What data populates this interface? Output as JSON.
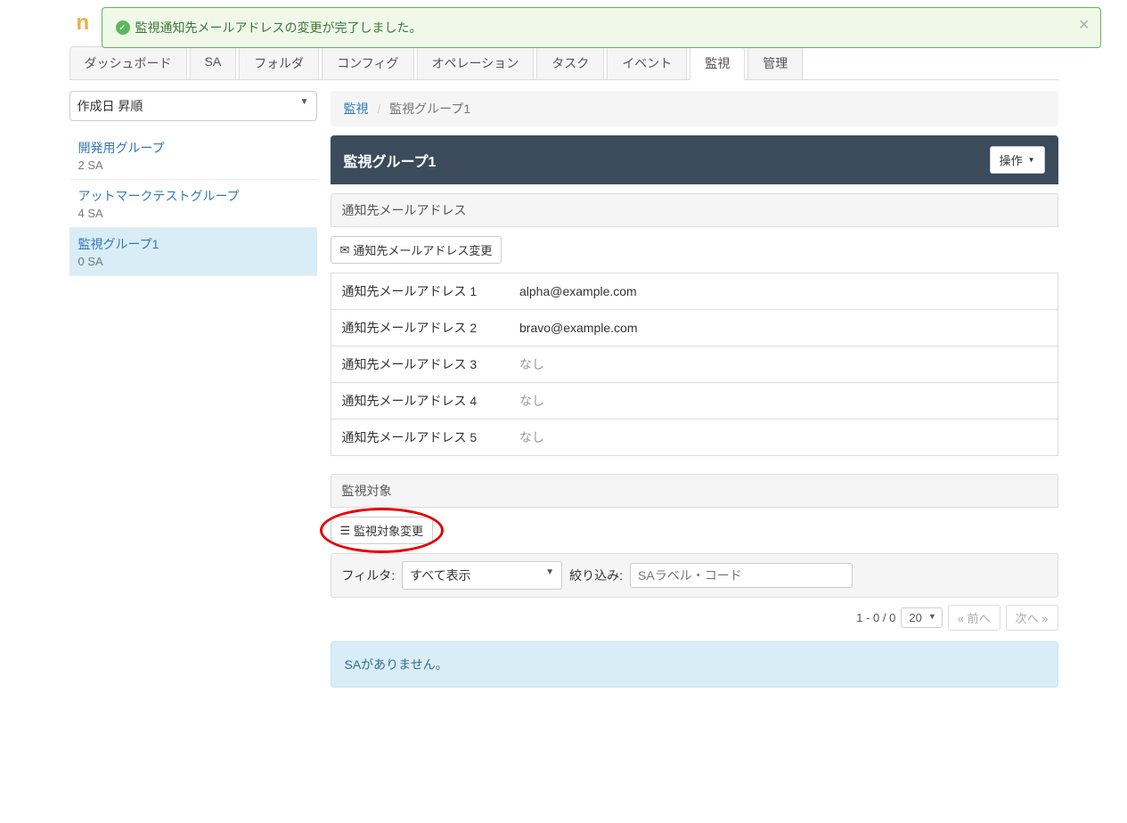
{
  "alert": {
    "message": "監視通知先メールアドレスの変更が完了しました。",
    "close": "×"
  },
  "logo": "n",
  "top_right_caret": "▼",
  "tabs": [
    "ダッシュボード",
    "SA",
    "フォルダ",
    "コンフィグ",
    "オペレーション",
    "タスク",
    "イベント",
    "監視",
    "管理"
  ],
  "active_tab_index": 7,
  "sidebar": {
    "sort": "作成日 昇順",
    "groups": [
      {
        "name": "開発用グループ",
        "sub": "2 SA",
        "active": false
      },
      {
        "name": "アットマークテストグループ",
        "sub": "4 SA",
        "active": false
      },
      {
        "name": "監視グループ1",
        "sub": "0 SA",
        "active": true
      }
    ]
  },
  "breadcrumb": {
    "root": "監視",
    "current": "監視グループ1"
  },
  "main": {
    "title": "監視グループ1",
    "actions_label": "操作",
    "email_section": {
      "header": "通知先メールアドレス",
      "change_btn": "通知先メールアドレス変更",
      "rows": [
        {
          "label": "通知先メールアドレス 1",
          "value": "alpha@example.com",
          "none": false
        },
        {
          "label": "通知先メールアドレス 2",
          "value": "bravo@example.com",
          "none": false
        },
        {
          "label": "通知先メールアドレス 3",
          "value": "なし",
          "none": true
        },
        {
          "label": "通知先メールアドレス 4",
          "value": "なし",
          "none": true
        },
        {
          "label": "通知先メールアドレス 5",
          "value": "なし",
          "none": true
        }
      ]
    },
    "target_section": {
      "header": "監視対象",
      "change_btn": "監視対象変更",
      "filter_label": "フィルタ:",
      "filter_value": "すべて表示",
      "refine_label": "絞り込み:",
      "refine_placeholder": "SAラベル・コード",
      "page_info": "1 - 0 / 0",
      "page_size": "20",
      "prev": "« 前へ",
      "next": "次へ »",
      "empty": "SAがありません。"
    }
  }
}
